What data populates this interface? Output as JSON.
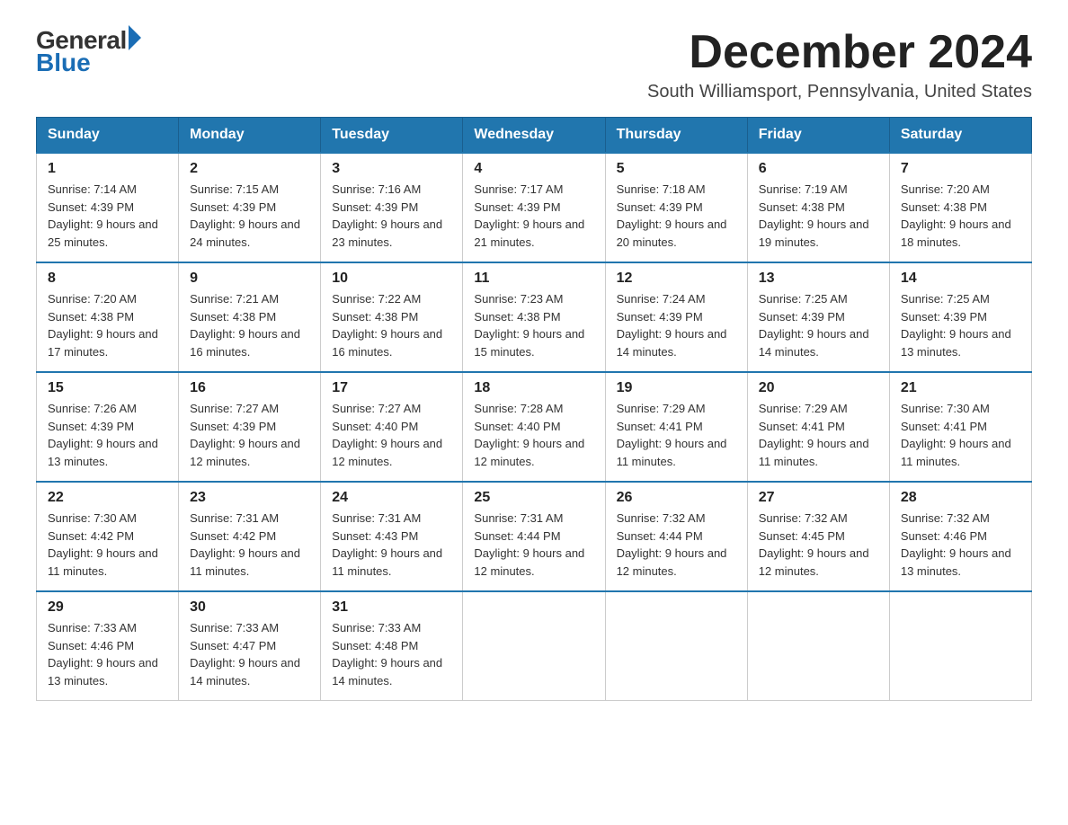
{
  "logo": {
    "text_general": "General",
    "text_blue": "Blue"
  },
  "title": {
    "month_year": "December 2024",
    "location": "South Williamsport, Pennsylvania, United States"
  },
  "weekdays": [
    "Sunday",
    "Monday",
    "Tuesday",
    "Wednesday",
    "Thursday",
    "Friday",
    "Saturday"
  ],
  "weeks": [
    [
      {
        "day": "1",
        "sunrise": "7:14 AM",
        "sunset": "4:39 PM",
        "daylight": "9 hours and 25 minutes."
      },
      {
        "day": "2",
        "sunrise": "7:15 AM",
        "sunset": "4:39 PM",
        "daylight": "9 hours and 24 minutes."
      },
      {
        "day": "3",
        "sunrise": "7:16 AM",
        "sunset": "4:39 PM",
        "daylight": "9 hours and 23 minutes."
      },
      {
        "day": "4",
        "sunrise": "7:17 AM",
        "sunset": "4:39 PM",
        "daylight": "9 hours and 21 minutes."
      },
      {
        "day": "5",
        "sunrise": "7:18 AM",
        "sunset": "4:39 PM",
        "daylight": "9 hours and 20 minutes."
      },
      {
        "day": "6",
        "sunrise": "7:19 AM",
        "sunset": "4:38 PM",
        "daylight": "9 hours and 19 minutes."
      },
      {
        "day": "7",
        "sunrise": "7:20 AM",
        "sunset": "4:38 PM",
        "daylight": "9 hours and 18 minutes."
      }
    ],
    [
      {
        "day": "8",
        "sunrise": "7:20 AM",
        "sunset": "4:38 PM",
        "daylight": "9 hours and 17 minutes."
      },
      {
        "day": "9",
        "sunrise": "7:21 AM",
        "sunset": "4:38 PM",
        "daylight": "9 hours and 16 minutes."
      },
      {
        "day": "10",
        "sunrise": "7:22 AM",
        "sunset": "4:38 PM",
        "daylight": "9 hours and 16 minutes."
      },
      {
        "day": "11",
        "sunrise": "7:23 AM",
        "sunset": "4:38 PM",
        "daylight": "9 hours and 15 minutes."
      },
      {
        "day": "12",
        "sunrise": "7:24 AM",
        "sunset": "4:39 PM",
        "daylight": "9 hours and 14 minutes."
      },
      {
        "day": "13",
        "sunrise": "7:25 AM",
        "sunset": "4:39 PM",
        "daylight": "9 hours and 14 minutes."
      },
      {
        "day": "14",
        "sunrise": "7:25 AM",
        "sunset": "4:39 PM",
        "daylight": "9 hours and 13 minutes."
      }
    ],
    [
      {
        "day": "15",
        "sunrise": "7:26 AM",
        "sunset": "4:39 PM",
        "daylight": "9 hours and 13 minutes."
      },
      {
        "day": "16",
        "sunrise": "7:27 AM",
        "sunset": "4:39 PM",
        "daylight": "9 hours and 12 minutes."
      },
      {
        "day": "17",
        "sunrise": "7:27 AM",
        "sunset": "4:40 PM",
        "daylight": "9 hours and 12 minutes."
      },
      {
        "day": "18",
        "sunrise": "7:28 AM",
        "sunset": "4:40 PM",
        "daylight": "9 hours and 12 minutes."
      },
      {
        "day": "19",
        "sunrise": "7:29 AM",
        "sunset": "4:41 PM",
        "daylight": "9 hours and 11 minutes."
      },
      {
        "day": "20",
        "sunrise": "7:29 AM",
        "sunset": "4:41 PM",
        "daylight": "9 hours and 11 minutes."
      },
      {
        "day": "21",
        "sunrise": "7:30 AM",
        "sunset": "4:41 PM",
        "daylight": "9 hours and 11 minutes."
      }
    ],
    [
      {
        "day": "22",
        "sunrise": "7:30 AM",
        "sunset": "4:42 PM",
        "daylight": "9 hours and 11 minutes."
      },
      {
        "day": "23",
        "sunrise": "7:31 AM",
        "sunset": "4:42 PM",
        "daylight": "9 hours and 11 minutes."
      },
      {
        "day": "24",
        "sunrise": "7:31 AM",
        "sunset": "4:43 PM",
        "daylight": "9 hours and 11 minutes."
      },
      {
        "day": "25",
        "sunrise": "7:31 AM",
        "sunset": "4:44 PM",
        "daylight": "9 hours and 12 minutes."
      },
      {
        "day": "26",
        "sunrise": "7:32 AM",
        "sunset": "4:44 PM",
        "daylight": "9 hours and 12 minutes."
      },
      {
        "day": "27",
        "sunrise": "7:32 AM",
        "sunset": "4:45 PM",
        "daylight": "9 hours and 12 minutes."
      },
      {
        "day": "28",
        "sunrise": "7:32 AM",
        "sunset": "4:46 PM",
        "daylight": "9 hours and 13 minutes."
      }
    ],
    [
      {
        "day": "29",
        "sunrise": "7:33 AM",
        "sunset": "4:46 PM",
        "daylight": "9 hours and 13 minutes."
      },
      {
        "day": "30",
        "sunrise": "7:33 AM",
        "sunset": "4:47 PM",
        "daylight": "9 hours and 14 minutes."
      },
      {
        "day": "31",
        "sunrise": "7:33 AM",
        "sunset": "4:48 PM",
        "daylight": "9 hours and 14 minutes."
      },
      null,
      null,
      null,
      null
    ]
  ]
}
